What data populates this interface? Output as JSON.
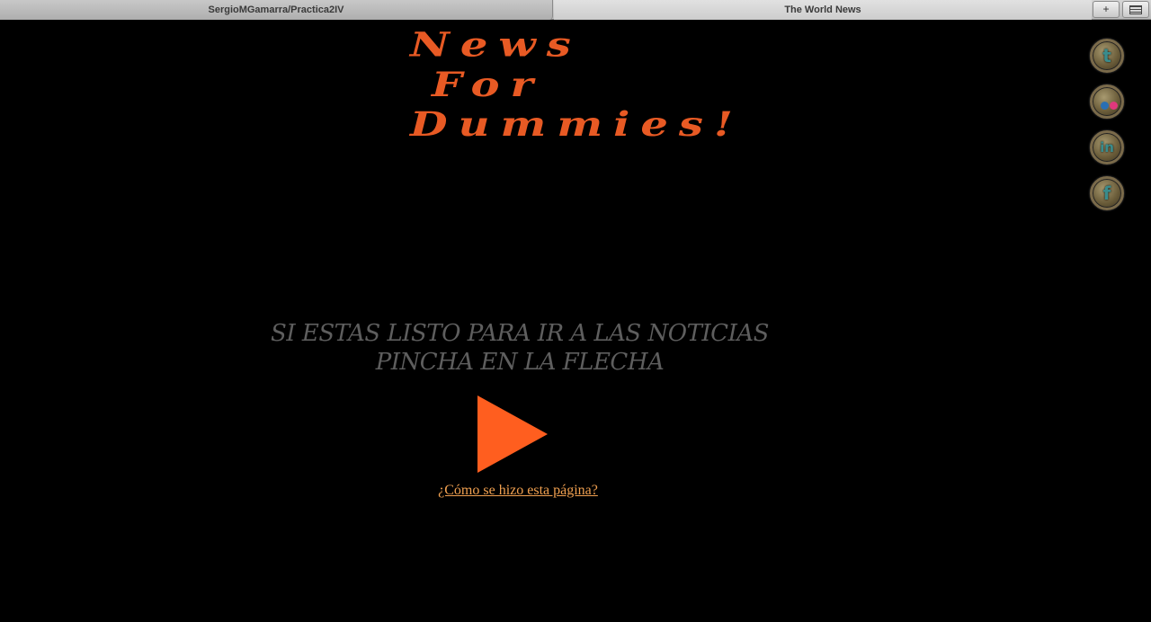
{
  "browser": {
    "tabs": [
      {
        "label": "SergioMGamarra/Practica2IV"
      },
      {
        "label": "The World News"
      }
    ],
    "new_tab_label": "+"
  },
  "header": {
    "logo_lines": [
      "News",
      "For",
      "Dummies!"
    ],
    "logo_color": "#e85a24"
  },
  "social": {
    "icons": [
      {
        "name": "twitter-icon",
        "glyph": "t"
      },
      {
        "name": "flickr-icon",
        "glyph": ""
      },
      {
        "name": "linkedin-icon",
        "glyph": "in"
      },
      {
        "name": "facebook-icon",
        "glyph": "f"
      }
    ]
  },
  "main": {
    "cta_line1": "SI ESTAS LISTO PARA IR A LAS NOTICIAS",
    "cta_line2": "PINCHA EN LA FLECHA",
    "arrow_color": "#ff5e1f",
    "howto_link": "¿Cómo se hizo esta página?"
  }
}
